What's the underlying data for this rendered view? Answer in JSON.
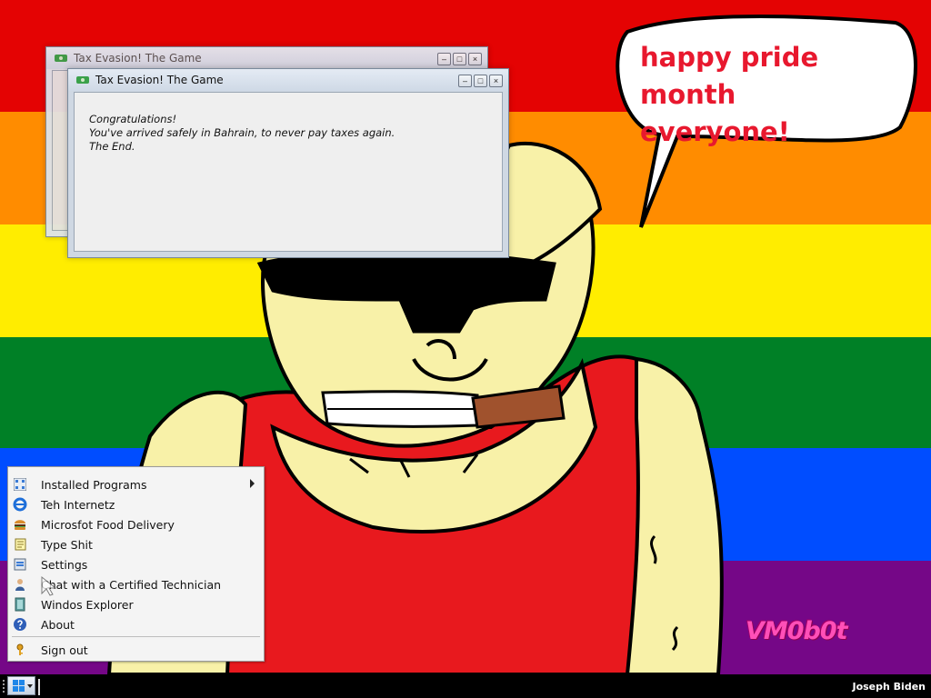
{
  "colors": {
    "pride_stripes": [
      "#e40303",
      "#ff8c00",
      "#ffed00",
      "#008026",
      "#004dff",
      "#750787"
    ],
    "speech_text": "#e8182e",
    "taskbar": "#000000",
    "menu_bg": "#f4f4f4"
  },
  "speech_bubble": {
    "line1": "happy pride month",
    "line2": "everyone!"
  },
  "watermark": "VM0b0t",
  "windows": {
    "back": {
      "title": "Tax Evasion! The Game"
    },
    "front": {
      "title": "Tax Evasion! The Game",
      "message_line1": "Congratulations!",
      "message_line2": "You've arrived safely in Bahrain, to never pay taxes again.",
      "message_line3": "The End."
    },
    "controls": {
      "minimize": "–",
      "maximize": "□",
      "close": "×"
    }
  },
  "start_menu": {
    "items": [
      {
        "label": "Installed Programs",
        "icon": "programs-grid-icon",
        "has_submenu": true
      },
      {
        "label": "Teh Internetz",
        "icon": "internet-explorer-icon",
        "has_submenu": false
      },
      {
        "label": "Microsfot Food Delivery",
        "icon": "burger-icon",
        "has_submenu": false
      },
      {
        "label": "Type Shit",
        "icon": "notepad-icon",
        "has_submenu": false
      },
      {
        "label": "Settings",
        "icon": "settings-icon",
        "has_submenu": false
      },
      {
        "label": "Chat with a Certified Technician",
        "icon": "technician-icon",
        "has_submenu": false
      },
      {
        "label": "Windos Explorer",
        "icon": "explorer-icon",
        "has_submenu": false
      },
      {
        "label": "About",
        "icon": "help-icon",
        "has_submenu": false
      }
    ],
    "sign_out": {
      "label": "Sign out",
      "icon": "key-icon"
    }
  },
  "taskbar": {
    "user_name": "Joseph Biden",
    "start_icon": "windows-logo-icon"
  }
}
